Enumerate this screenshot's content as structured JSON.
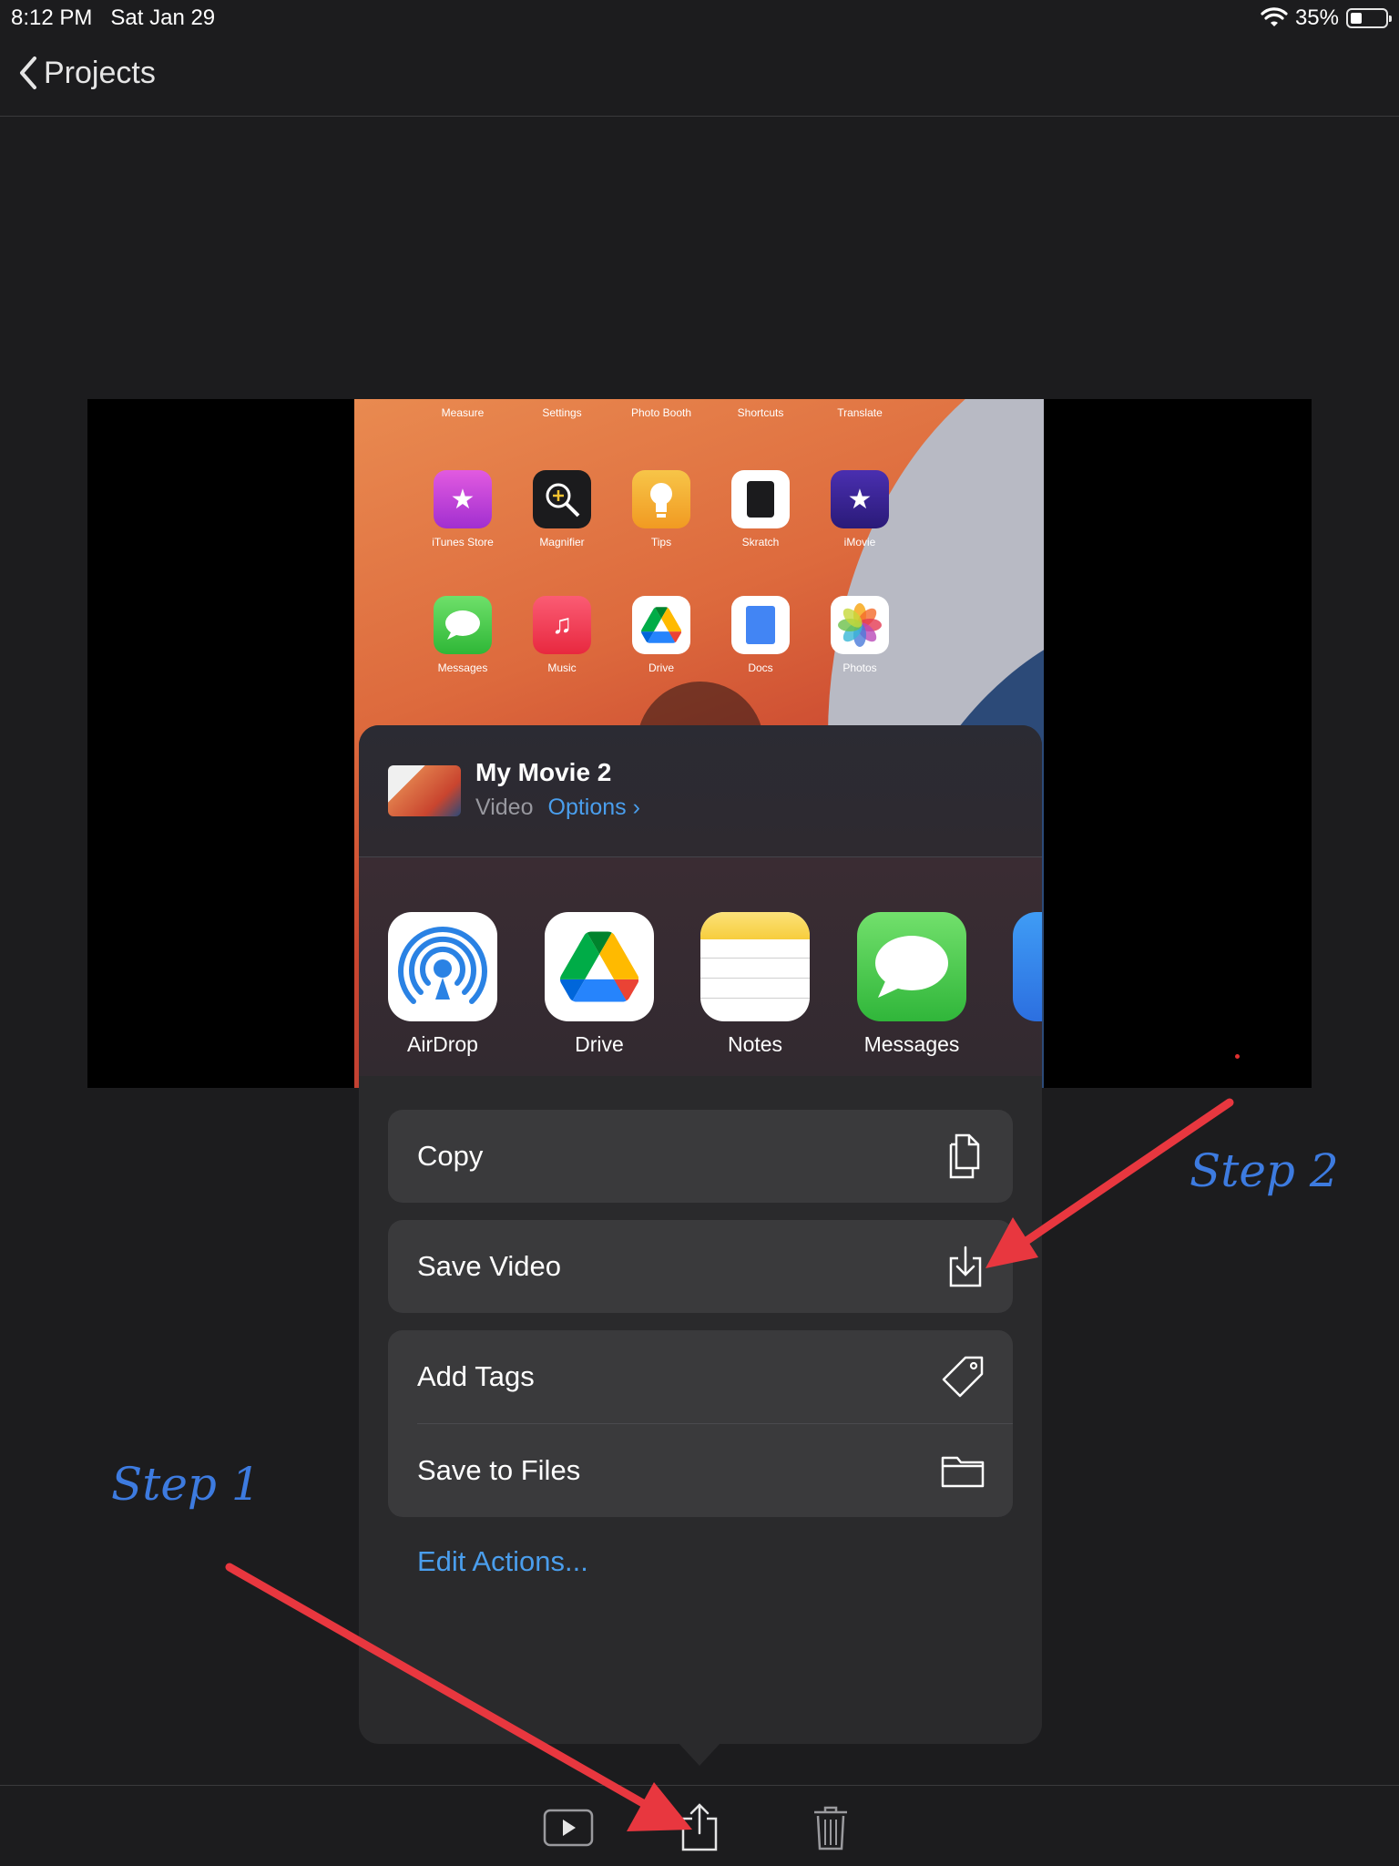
{
  "status_bar": {
    "time": "8:12 PM",
    "date": "Sat Jan 29",
    "battery_percent": "35%",
    "battery_level": 0.35
  },
  "nav": {
    "back_label": "Projects"
  },
  "preview": {
    "top_row_labels": [
      "Measure",
      "Settings",
      "Photo Booth",
      "Shortcuts",
      "Translate"
    ],
    "row2": [
      {
        "label": "iTunes Store",
        "icon": "star-icon"
      },
      {
        "label": "Magnifier",
        "icon": "magnifier-icon"
      },
      {
        "label": "Tips",
        "icon": "lightbulb-icon"
      },
      {
        "label": "Skratch",
        "icon": "skratch-icon"
      },
      {
        "label": "iMovie",
        "icon": "imovie-icon"
      }
    ],
    "row3": [
      {
        "label": "Messages",
        "icon": "messages-icon"
      },
      {
        "label": "Music",
        "icon": "music-icon"
      },
      {
        "label": "Drive",
        "icon": "drive-icon"
      },
      {
        "label": "Docs",
        "icon": "docs-icon"
      },
      {
        "label": "Photos",
        "icon": "photos-icon"
      }
    ]
  },
  "share_sheet": {
    "title": "My Movie 2",
    "type_label": "Video",
    "options_label": "Options",
    "apps": [
      {
        "label": "AirDrop",
        "icon": "airdrop-icon"
      },
      {
        "label": "Drive",
        "icon": "drive-icon"
      },
      {
        "label": "Notes",
        "icon": "notes-icon"
      },
      {
        "label": "Messages",
        "icon": "messages-icon"
      }
    ],
    "actions": {
      "copy": "Copy",
      "save_video": "Save Video",
      "add_tags": "Add Tags",
      "save_to_files": "Save to Files"
    },
    "edit_actions": "Edit Actions..."
  },
  "annotations": {
    "step1": "Step 1",
    "step2": "Step 2",
    "arrow_color": "#e8373f",
    "text_color": "#3d7be0"
  },
  "colors": {
    "accent": "#4a9eed",
    "background": "#1c1c1e"
  }
}
